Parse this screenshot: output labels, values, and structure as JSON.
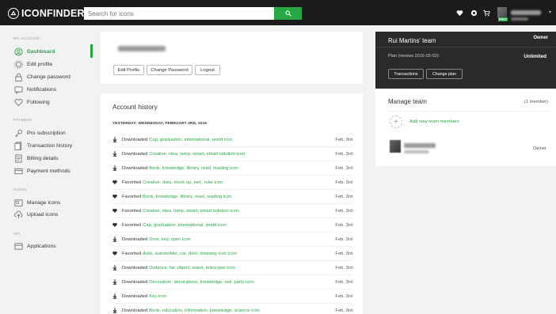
{
  "brand": {
    "name": "ICONFINDER"
  },
  "search": {
    "placeholder": "Search for icons"
  },
  "topbar": {
    "pro_badge": "PRO"
  },
  "sidebar": {
    "sections": [
      {
        "title": "MY ACCOUNT",
        "items": [
          {
            "label": "Dashboard",
            "icon": "dashboard-icon",
            "active": true
          },
          {
            "label": "Edit profile",
            "icon": "gear-icon"
          },
          {
            "label": "Change password",
            "icon": "lock-icon"
          },
          {
            "label": "Notifications",
            "icon": "chat-icon"
          },
          {
            "label": "Following",
            "icon": "heart-icon"
          }
        ]
      },
      {
        "title": "PAYMENT",
        "items": [
          {
            "label": "Pro subscription",
            "icon": "key-icon"
          },
          {
            "label": "Transaction history",
            "icon": "history-icon"
          },
          {
            "label": "Billing details",
            "icon": "document-icon"
          },
          {
            "label": "Payment methods",
            "icon": "credit-card-icon"
          }
        ]
      },
      {
        "title": "ICONS",
        "items": [
          {
            "label": "Manage icons",
            "icon": "folder-icon"
          },
          {
            "label": "Upload icons",
            "icon": "cloud-upload-icon"
          }
        ]
      },
      {
        "title": "API",
        "items": [
          {
            "label": "Applications",
            "icon": "window-icon"
          }
        ]
      }
    ]
  },
  "profile": {
    "buttons": {
      "edit": "Edit Profile",
      "password": "Change Password",
      "logout": "Logout"
    }
  },
  "history": {
    "title": "Account history",
    "date_header": "YESTERDAY: WEDNESDAY, FEBRUARY 3RD, 2016",
    "rows": [
      {
        "type": "download",
        "action": "Downloaded",
        "link": "Cap, graduation, international, world icon",
        "date": "Feb. 3rd"
      },
      {
        "type": "download",
        "action": "Downloaded",
        "link": "Creative, idea, lamp, smart, smart solution icon",
        "date": "Feb. 3rd"
      },
      {
        "type": "download",
        "action": "Downloaded",
        "link": "Book, knowledge, library, read, reading icon",
        "date": "Feb. 3rd"
      },
      {
        "type": "favorite",
        "action": "Favorited",
        "link": "Creative, data, mock up, pen, ruler icon",
        "date": "Feb. 3rd"
      },
      {
        "type": "favorite",
        "action": "Favorited",
        "link": "Book, knowledge, library, read, reading icon",
        "date": "Feb. 3rd"
      },
      {
        "type": "favorite",
        "action": "Favorited",
        "link": "Creative, idea, lamp, smart, smart solution icon",
        "date": "Feb. 3rd"
      },
      {
        "type": "favorite",
        "action": "Favorited",
        "link": "Cap, graduation, international, world icon",
        "date": "Feb. 3rd"
      },
      {
        "type": "download",
        "action": "Downloaded",
        "link": "Door, key, open icon",
        "date": "Feb. 3rd"
      },
      {
        "type": "favorite",
        "action": "Favorited",
        "link": "Auto, automobile, car, door, doorway icon icon",
        "date": "Feb. 3rd"
      },
      {
        "type": "download",
        "action": "Downloaded",
        "link": "Distance, far, object, stand, telescope icon",
        "date": "Feb. 3rd"
      },
      {
        "type": "download",
        "action": "Downloaded",
        "link": "Decoration, decorations, knowledge, owl, party icon",
        "date": "Feb. 3rd"
      },
      {
        "type": "download",
        "action": "Downloaded",
        "link": "Key icon",
        "date": "Feb. 3rd"
      },
      {
        "type": "download",
        "action": "Downloaded",
        "link": "Book, education, information, knowledge, science icon",
        "date": "Feb. 3rd"
      }
    ]
  },
  "team": {
    "name": "Rui Martins' team",
    "role": "Owner",
    "plan_text": "Plan (renews 2016-03-02):",
    "plan_value": "Unlimited",
    "buttons": {
      "transactions": "Transactions",
      "change_plan": "Change plan"
    }
  },
  "manage_team": {
    "title": "Manage team",
    "count": "(1 member)",
    "add_label": "Add new team members",
    "member_role": "Owner"
  },
  "colors": {
    "accent": "#27a844",
    "topbar": "#1b1b1b",
    "team_card": "#2a2a2a"
  }
}
